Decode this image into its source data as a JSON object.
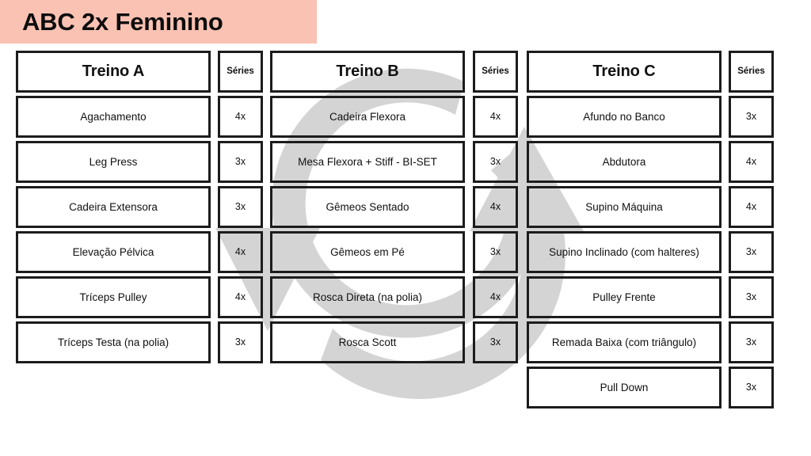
{
  "document": {
    "title": "ABC 2x Feminino",
    "banner_color": "#fac2b3",
    "text_color": "#111111",
    "border_color": "#1c1c1c",
    "watermark_color": "#d4d4d4",
    "watermark_icon": "circular-arrows-refresh-icon"
  },
  "table": {
    "columns": [
      {
        "key": "treino_a",
        "header": "Treino A",
        "sets_header": "Séries",
        "rows": [
          {
            "exercise": "Agachamento",
            "sets": "4x"
          },
          {
            "exercise": "Leg Press",
            "sets": "3x"
          },
          {
            "exercise": "Cadeira Extensora",
            "sets": "3x"
          },
          {
            "exercise": "Elevação Pélvica",
            "sets": "4x"
          },
          {
            "exercise": "Tríceps Pulley",
            "sets": "4x"
          },
          {
            "exercise": "Tríceps Testa (na polia)",
            "sets": "3x"
          }
        ]
      },
      {
        "key": "treino_b",
        "header": "Treino B",
        "sets_header": "Séries",
        "rows": [
          {
            "exercise": "Cadeira Flexora",
            "sets": "4x"
          },
          {
            "exercise": "Mesa Flexora + Stiff - BI-SET",
            "sets": "3x"
          },
          {
            "exercise": "Gêmeos Sentado",
            "sets": "4x"
          },
          {
            "exercise": "Gêmeos em Pé",
            "sets": "3x"
          },
          {
            "exercise": "Rosca Direta (na polia)",
            "sets": "4x"
          },
          {
            "exercise": "Rosca Scott",
            "sets": "3x"
          }
        ]
      },
      {
        "key": "treino_c",
        "header": "Treino C",
        "sets_header": "Séries",
        "rows": [
          {
            "exercise": "Afundo no Banco",
            "sets": "3x"
          },
          {
            "exercise": "Abdutora",
            "sets": "4x"
          },
          {
            "exercise": "Supino Máquina",
            "sets": "4x"
          },
          {
            "exercise": "Supino Inclinado (com halteres)",
            "sets": "3x"
          },
          {
            "exercise": "Pulley Frente",
            "sets": "3x"
          },
          {
            "exercise": "Remada Baixa (com triângulo)",
            "sets": "3x"
          },
          {
            "exercise": "Pull Down",
            "sets": "3x"
          }
        ]
      }
    ]
  }
}
